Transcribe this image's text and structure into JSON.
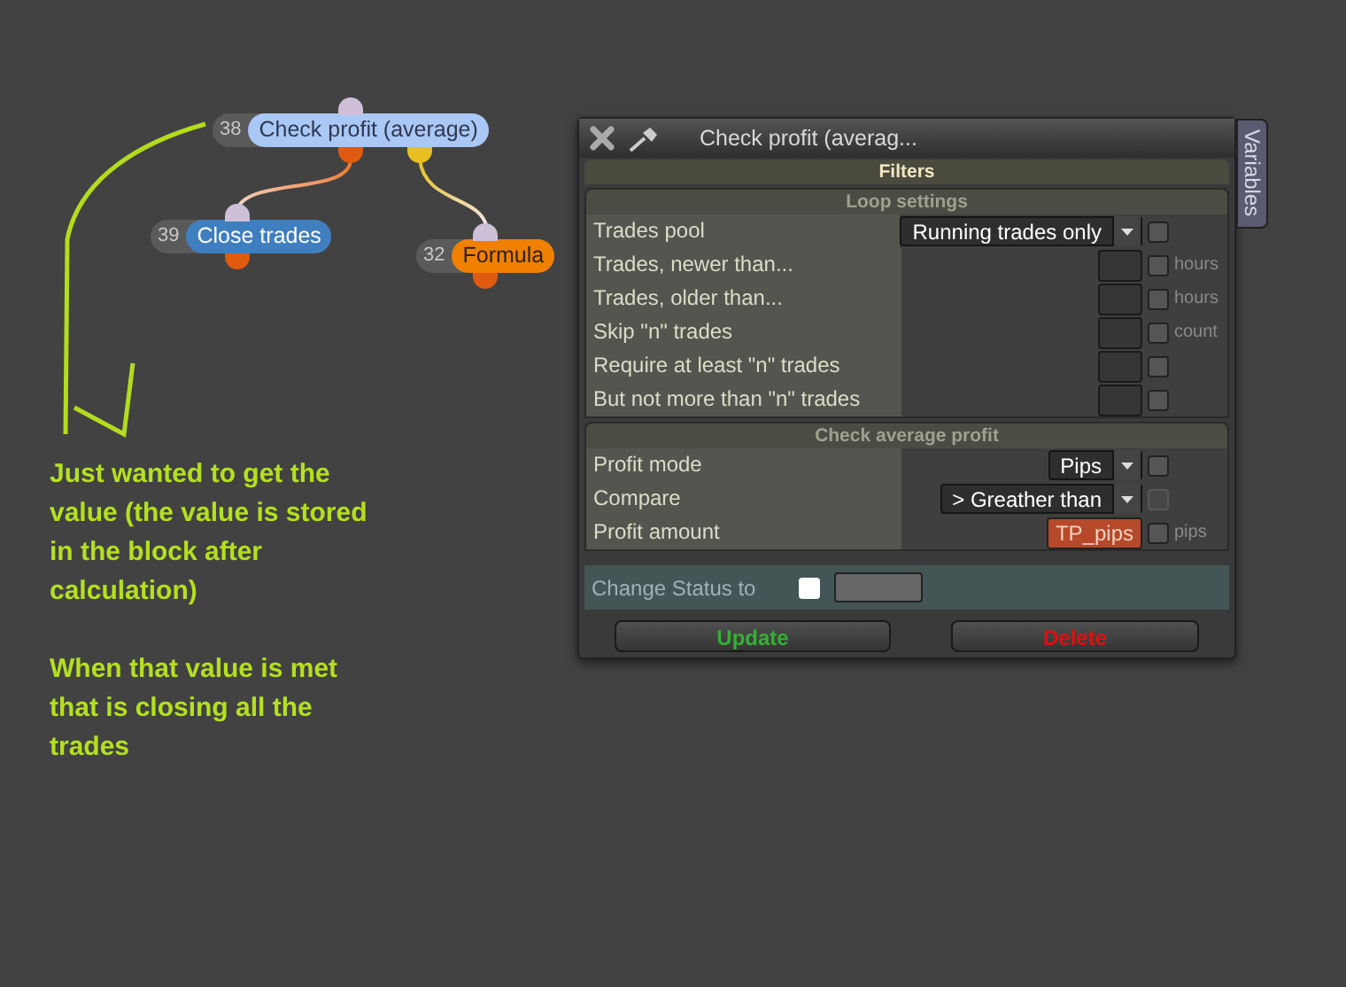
{
  "nodes": [
    {
      "number": "38",
      "label": "Check profit (average)",
      "kind": "condition"
    },
    {
      "number": "39",
      "label": "Close trades",
      "kind": "action"
    },
    {
      "number": "32",
      "label": "Formula",
      "kind": "formula"
    }
  ],
  "annotation": [
    "Just wanted to get the value (the value is stored in the block after calculation)",
    "When that value is met that is closing all the trades"
  ],
  "dialog": {
    "title": "Check profit (averag...",
    "side_tab": "Variables",
    "header": "Filters",
    "sections": [
      {
        "title": "Loop settings",
        "rows": [
          {
            "label": "Trades pool",
            "kind": "dropdown",
            "value": "Running trades only",
            "checked": false,
            "disabled": false
          },
          {
            "label": "Trades, newer than...",
            "kind": "input",
            "unit": "hours",
            "checked": false,
            "disabled": false
          },
          {
            "label": "Trades, older than...",
            "kind": "input",
            "unit": "hours",
            "checked": false,
            "disabled": false
          },
          {
            "label": "Skip \"n\" trades",
            "kind": "input",
            "unit": "count",
            "checked": false,
            "disabled": false
          },
          {
            "label": "Require at least \"n\" trades",
            "kind": "input",
            "checked": false,
            "disabled": false
          },
          {
            "label": "But not more than \"n\" trades",
            "kind": "input",
            "checked": false,
            "disabled": false
          }
        ]
      },
      {
        "title": "Check average profit",
        "rows": [
          {
            "label": "Profit mode",
            "kind": "dropdown",
            "value": "Pips",
            "checked": false,
            "disabled": false
          },
          {
            "label": "Compare",
            "kind": "dropdown",
            "value": "> Greather than",
            "checked": false,
            "disabled": true
          },
          {
            "label": "Profit amount",
            "kind": "variable",
            "value": "TP_pips",
            "unit": "pips",
            "checked": false,
            "disabled": false
          }
        ]
      }
    ],
    "status": {
      "label": "Change Status to",
      "checked": false
    },
    "buttons": [
      {
        "label": "Update",
        "kind": "update"
      },
      {
        "label": "Delete",
        "kind": "delete"
      }
    ]
  }
}
